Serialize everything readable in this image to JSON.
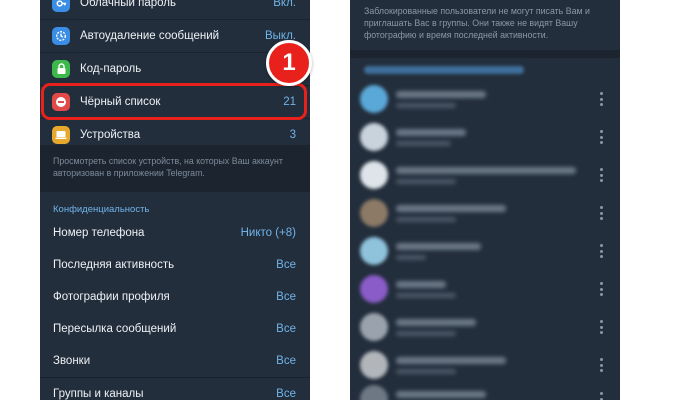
{
  "security": {
    "items": [
      {
        "icon": "key-icon",
        "label": "Облачный пароль",
        "value": "Вкл.",
        "color": "#3a8ee6"
      },
      {
        "icon": "timer-icon",
        "label": "Автоудаление сообщений",
        "value": "Выкл.",
        "color": "#3a8ee6"
      },
      {
        "icon": "lock-icon",
        "label": "Код-пароль",
        "value": "",
        "color": "#3db84a"
      },
      {
        "icon": "block-icon",
        "label": "Чёрный список",
        "value": "21",
        "color": "#e24a4a"
      },
      {
        "icon": "devices-icon",
        "label": "Устройства",
        "value": "3",
        "color": "#e6a92d"
      }
    ],
    "hint": "Просмотреть список устройств, на которых Ваш аккаунт авторизован в приложении Telegram."
  },
  "privacy": {
    "header": "Конфиденциальность",
    "items": [
      {
        "label": "Номер телефона",
        "value": "Никто (+8)"
      },
      {
        "label": "Последняя активность",
        "value": "Все"
      },
      {
        "label": "Фотографии профиля",
        "value": "Все"
      },
      {
        "label": "Пересылка сообщений",
        "value": "Все"
      },
      {
        "label": "Звонки",
        "value": "Все"
      },
      {
        "label": "Группы и каналы",
        "value": "Все"
      }
    ]
  },
  "annotation": {
    "step_number": "1",
    "color": "#e8211c"
  },
  "blocked": {
    "hint": "Заблокированные пользователи не могут писать Вам и приглашать Вас в группы. Они также не видят Вашу фотографию и время последней активности."
  }
}
